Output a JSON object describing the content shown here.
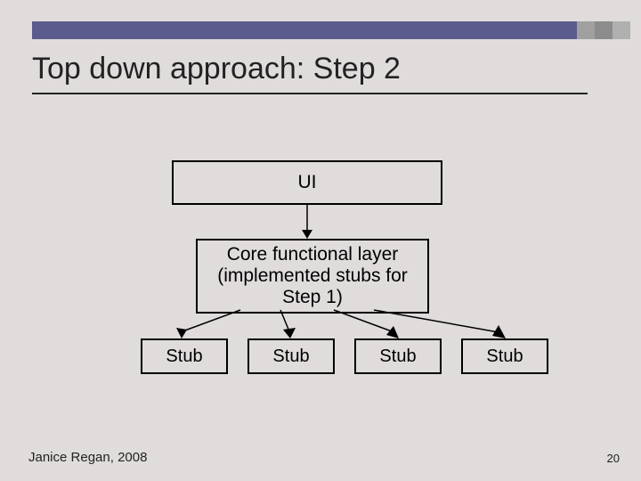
{
  "title": "Top down approach:  Step 2",
  "diagram": {
    "ui_label": "UI",
    "core_label": "Core functional layer (implemented stubs for Step 1)",
    "stub_label": "Stub"
  },
  "footer": {
    "author": "Janice Regan, 2008",
    "page_number": "20"
  }
}
